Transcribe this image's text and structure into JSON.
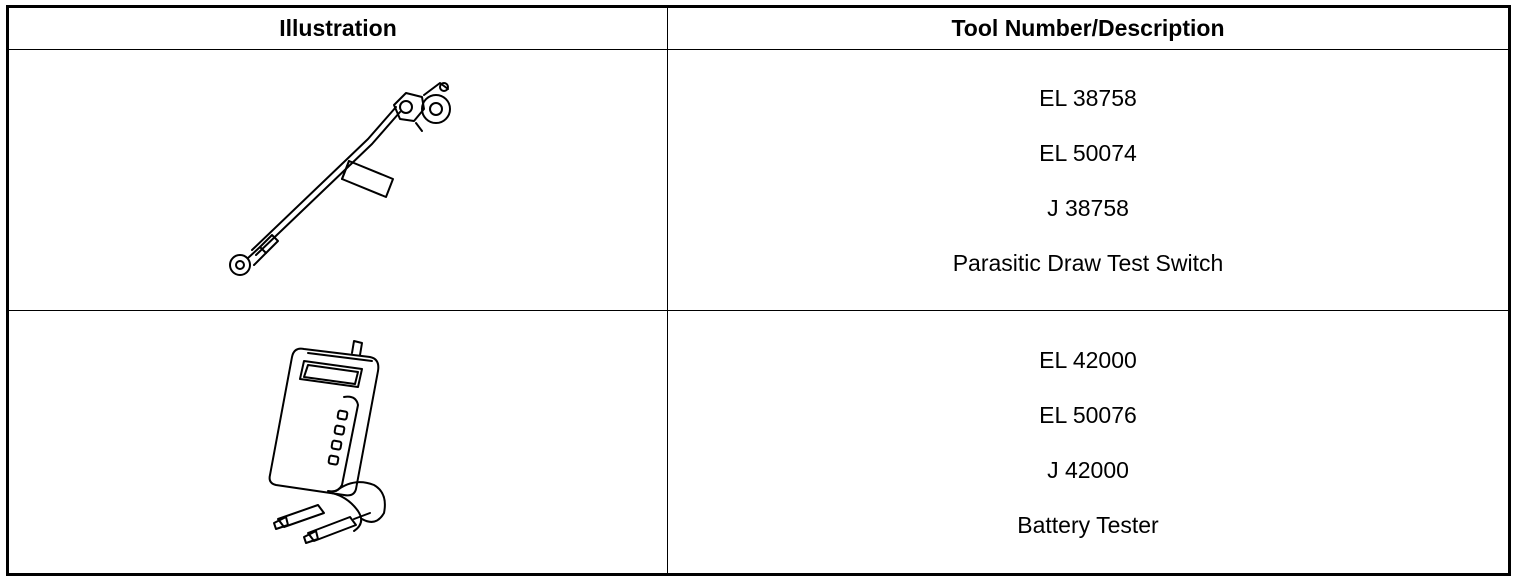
{
  "table": {
    "headers": [
      "Illustration",
      "Tool Number/Description"
    ],
    "rows": [
      {
        "illustration_icon": "parasitic-draw-test-switch-drawing",
        "lines": [
          "EL 38758",
          "EL 50074",
          "J 38758",
          "Parasitic Draw Test Switch"
        ]
      },
      {
        "illustration_icon": "battery-tester-drawing",
        "lines": [
          "EL 42000",
          "EL 50076",
          "J 42000",
          "Battery Tester"
        ]
      }
    ]
  }
}
